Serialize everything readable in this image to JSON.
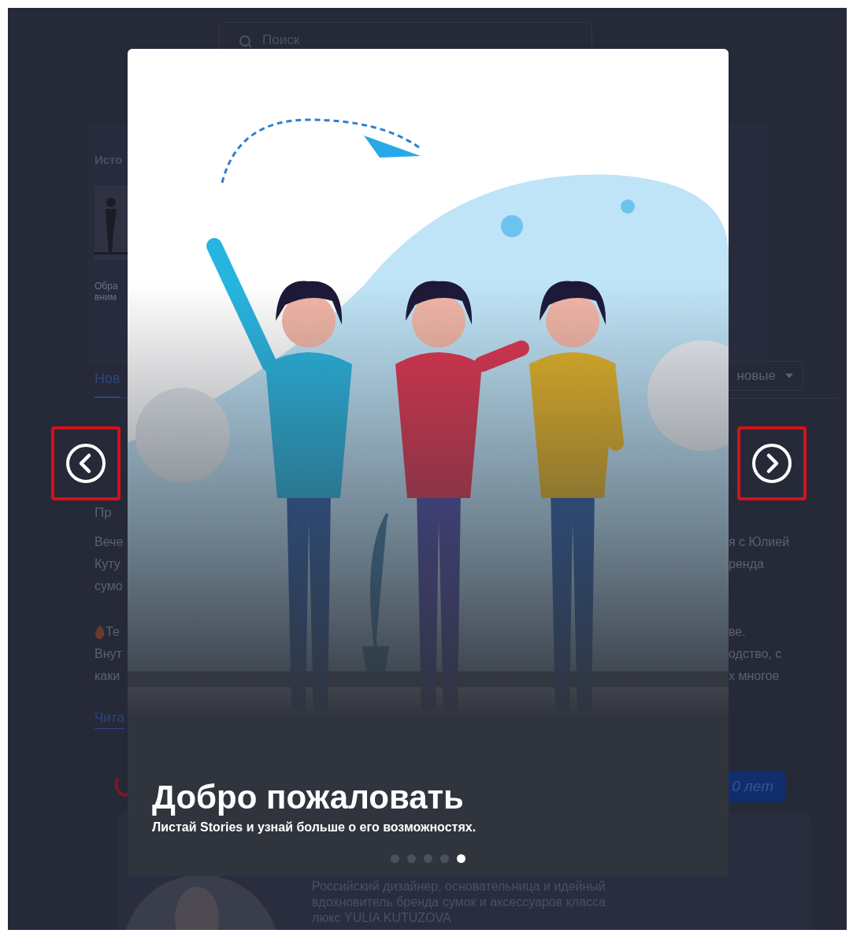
{
  "search": {
    "placeholder": "Поиск"
  },
  "page": {
    "section_title": "Исто",
    "thumb_caption": [
      "Обра",
      "вним"
    ],
    "tabs": [
      {
        "label": "Нов",
        "selected": true
      }
    ],
    "sort": {
      "value": "новые"
    },
    "post_title": "Пр",
    "paragraphs": [
      {
        "lines": [
          {
            "left": "Вече",
            "right": "я с Юлией"
          },
          {
            "left": "Куту",
            "right": "ренда"
          },
          {
            "left": "сумо"
          }
        ]
      },
      {
        "lines": [
          {
            "left": "Те",
            "right": "ве.",
            "emoji": true
          },
          {
            "left": "Внут",
            "right": "одство, с"
          },
          {
            "left": "каки",
            "right": "х многое"
          }
        ]
      }
    ],
    "read_more": "Чита",
    "age_button": "0 лет",
    "author_bio": [
      "Российский дизайнер, основательница и идейный",
      "вдохновитель бренда сумок и аксессуаров класса",
      "люкс YULIA KUTUZOVA"
    ]
  },
  "story": {
    "title": "Добро пожаловать",
    "subtitle": "Листай Stories и узнай больше о его возможностях.",
    "pages": [
      {
        "selected": false
      },
      {
        "selected": false
      },
      {
        "selected": false
      },
      {
        "selected": false
      },
      {
        "selected": true
      }
    ]
  },
  "nav": {
    "prev": {
      "highlighted": true
    },
    "next": {
      "highlighted": true
    }
  }
}
